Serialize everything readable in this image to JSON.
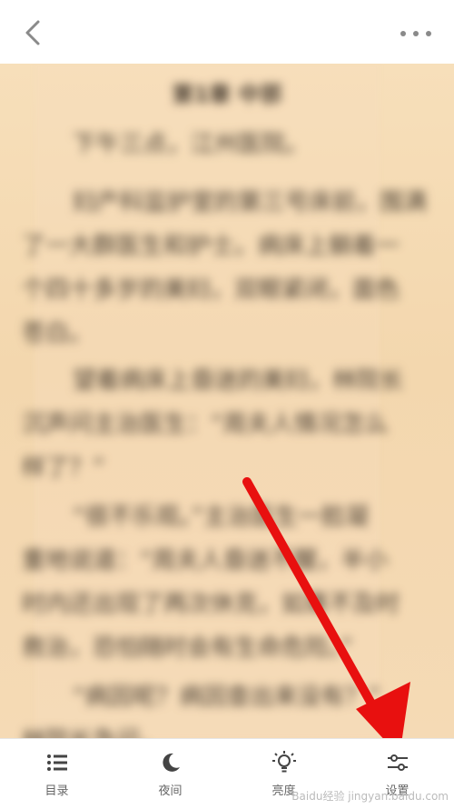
{
  "topbar": {
    "back_icon": "chevron-left-icon",
    "more_icon": "more-dots-icon"
  },
  "reader": {
    "chapter_title": "第1章 中邪",
    "lines": [
      "下午三点，江州医院。",
      "妇产科监护室的第三号床前，围满",
      "了一大群医生和护士。病床上躺着一",
      "个四十多岁的美妇，双眼紧闭，面色",
      "苍白。",
      "望着病床上昏迷的美妇，林院长",
      "沉声问主治医生：“周夫人情况怎么",
      "样了？”",
      "“很不乐观。”主治医生一脸凝",
      "重地说道：“周夫人昏迷不醒，半小",
      "时内还出现了两次休克，如果不及时",
      "救治，恐怕随时会有生命危险。”",
      "“病因呢？病因查出来没有？”",
      "林院长急问。"
    ]
  },
  "bottom_nav": [
    {
      "label": "目录",
      "icon": "list-icon"
    },
    {
      "label": "夜间",
      "icon": "moon-icon"
    },
    {
      "label": "亮度",
      "icon": "lightbulb-icon"
    },
    {
      "label": "设置",
      "icon": "settings-sliders-icon"
    }
  ],
  "watermark": "Baidu经验 jingyan.baidu.com"
}
